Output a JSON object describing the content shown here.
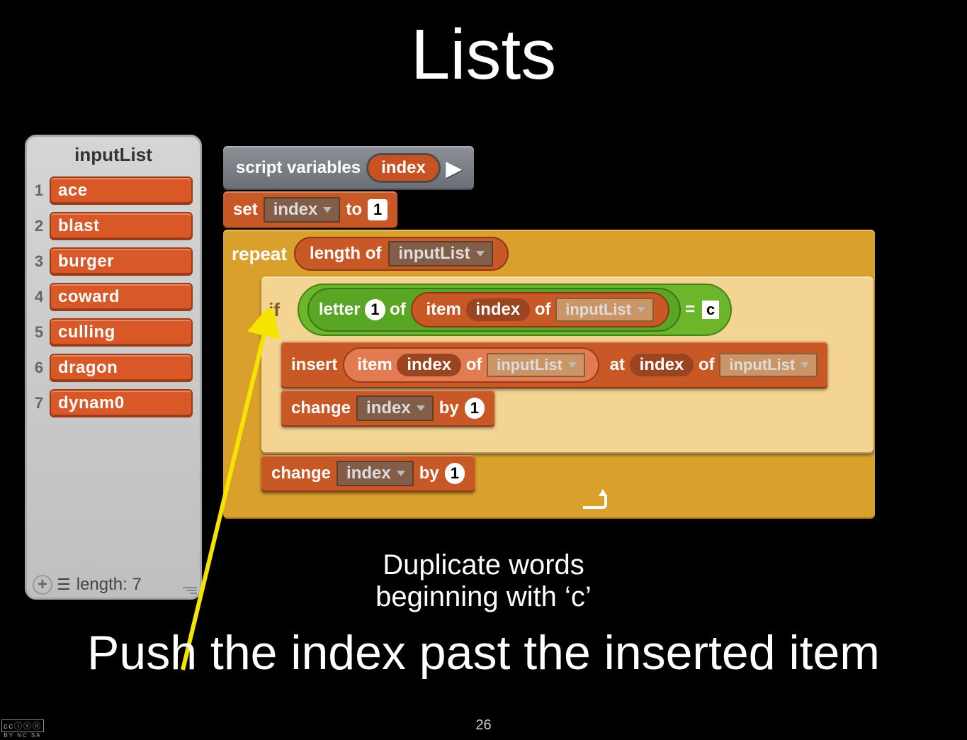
{
  "title": "Lists",
  "listWatcher": {
    "title": "inputList",
    "lengthLabel": "length: 7"
  },
  "items": [
    {
      "idx": "1",
      "val": "ace"
    },
    {
      "idx": "2",
      "val": "blast"
    },
    {
      "idx": "3",
      "val": "burger"
    },
    {
      "idx": "4",
      "val": "coward"
    },
    {
      "idx": "5",
      "val": "culling"
    },
    {
      "idx": "6",
      "val": "dragon"
    },
    {
      "idx": "7",
      "val": "dynam0"
    }
  ],
  "blocks": {
    "scriptVars": "script variables",
    "indexVar": "index",
    "set": "set",
    "to": "to",
    "one": "1",
    "repeat": "repeat",
    "lengthOf": "length of",
    "inputListDD": "inputList",
    "ifText": "if",
    "letter": "letter",
    "of": "of",
    "item": "item",
    "eq": "=",
    "c": "c",
    "insert": "insert",
    "at": "at",
    "change": "change",
    "by": "by",
    "arrow": "▶"
  },
  "captions": {
    "line1a": "Duplicate words",
    "line1b": "beginning with ‘c’",
    "line2": "Push the index past the inserted item"
  },
  "slideNumber": "26",
  "cc": {
    "row1": "ccⓘⓢⓞ",
    "row2": "BY  NC  SA"
  }
}
